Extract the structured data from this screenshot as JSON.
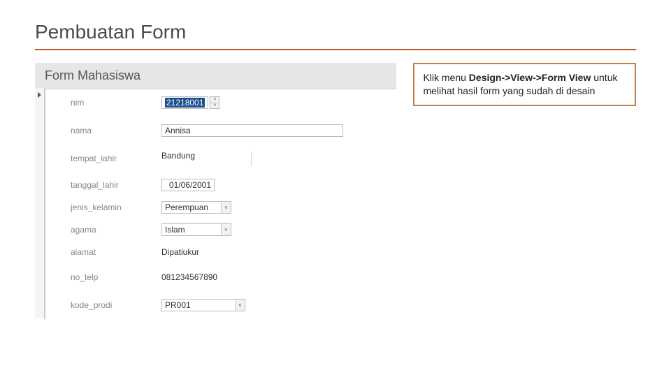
{
  "slide": {
    "title": "Pembuatan Form"
  },
  "form": {
    "header": "Form Mahasiswa",
    "fields": {
      "nim": {
        "label": "nim",
        "value": "21218001"
      },
      "nama": {
        "label": "nama",
        "value": "Annisa"
      },
      "tempat_lahir": {
        "label": "tempat_lahir",
        "value": "Bandung"
      },
      "tanggal_lahir": {
        "label": "tanggal_lahir",
        "value": "01/06/2001"
      },
      "jenis_kelamin": {
        "label": "jenis_kelamin",
        "value": "Perempuan"
      },
      "agama": {
        "label": "agama",
        "value": "Islam"
      },
      "alamat": {
        "label": "alamat",
        "value": "Dipatiukur"
      },
      "no_telp": {
        "label": "no_telp",
        "value": "081234567890"
      },
      "kode_prodi": {
        "label": "kode_prodi",
        "value": "PR001"
      }
    }
  },
  "note": {
    "line1a": "Klik menu ",
    "line1b": "Design->View->Form View",
    "line2": "untuk melihat hasil form yang sudah di desain"
  }
}
